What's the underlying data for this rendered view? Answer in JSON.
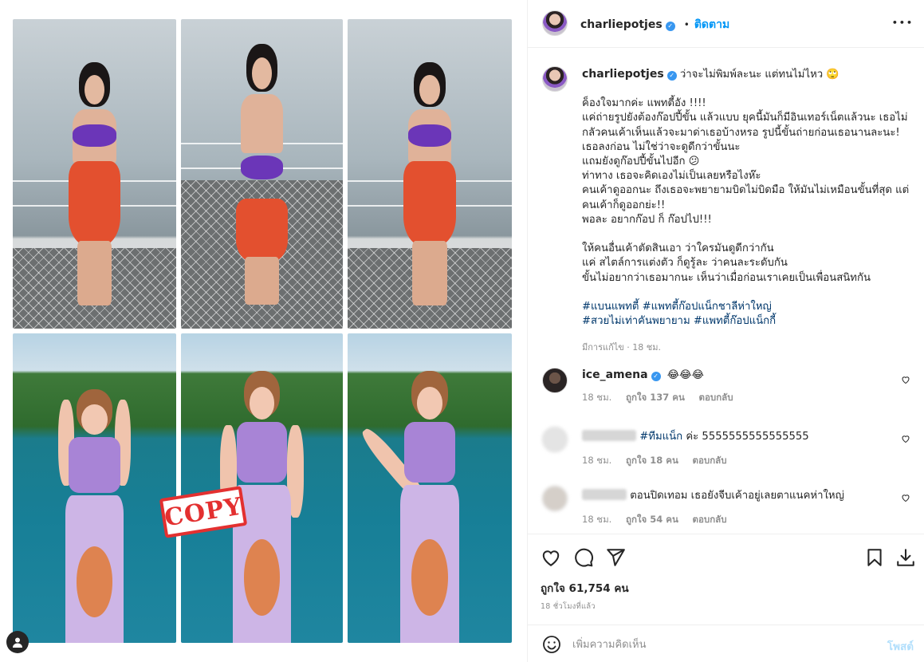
{
  "header": {
    "username": "charliepotjes",
    "verified_icon": "verified-badge-icon",
    "separator": "•",
    "follow_label": "ติดตาม",
    "more_icon": "more-options-icon",
    "more_label": "•••"
  },
  "caption": {
    "username": "charliepotjes",
    "first_line": "ว่าจะไม่พิมพ์ละนะ แต่ทนไม่ไหว 🙄",
    "lines": [
      "ค็องใจมากค่ะ แพทตี้อัง !!!!",
      "แค่ถ่ายรูปยังต้องก๊อปปี้ขั้น แล้วแบบ ยุคนี้มันก็มีอินเทอร์เน็ตแล้วนะ เธอไม่",
      "กลัวคนเค้าเห็นแล้วจะมาด่าเธอบ้างหรอ รูปนี้ขั้นถ่ายก่อนเธอนานละนะ!",
      "เธอลงก่อน ไม่ใช่ว่าจะดูดีกว่าขั้นนะ",
      "แถมยังดูก๊อปปี้ขั้นไปอีก 😕",
      "ท่าทาง เธอจะคิดเองไม่เป็นเลยหรือไงห๊ะ",
      "คนเค้าดูออกนะ ถึงเธอจะพยายามบิดไม่บิดมือ ให้มันไม่เหมือนขั้นที่สุด แต่",
      "คนเค้าก็ดูออกย่ะ!!",
      "พอละ อยากก๊อป ก็ ก๊อปไป!!!",
      "",
      "ให้คนอื่นเค้าตัดสินเอา ว่าใครมันดูดีกว่ากัน",
      "แค่ สไตล์การแต่งตัว ก็ดูรู้ละ ว่าคนละระดับกัน",
      "ขั้นไม่อยากว่าเธอมากนะ เห็นว่าเมื่อก่อนเราเคยเป็นเพื่อนสนิทกัน"
    ],
    "hashtags_line1": "#แบนแพทตี้ #แพทตี้ก๊อปแน็กชาลีห่าใหญ่",
    "hashtags_line2": "#สวยไม่เท่าคันพยายาม #แพทตี้ก๊อปแน็กกี้",
    "meta": "มีการแก้ไข · 18 ชม."
  },
  "comments": [
    {
      "username": "ice_amena",
      "verified": true,
      "text": "😂😂😂",
      "time": "18 ชม.",
      "likes": "ถูกใจ 137 คน",
      "reply": "ตอบกลับ"
    },
    {
      "username": "",
      "hashtag": "#ทีมแน็ก",
      "text": " ค่ะ 5555555555555555",
      "time": "18 ชม.",
      "likes": "ถูกใจ 18 คน",
      "reply": "ตอบกลับ"
    },
    {
      "username": "",
      "text": "ตอนปิดเทอม เธอยังจีบเค้าอยู่เลยตาแนคห่าใหญ่",
      "time": "18 ชม.",
      "likes": "ถูกใจ 54 คน",
      "reply": "ตอบกลับ"
    }
  ],
  "actions": {
    "like_icon": "heart-icon",
    "comment_icon": "comment-icon",
    "share_icon": "share-icon",
    "save_icon": "bookmark-icon",
    "download_icon": "download-icon",
    "likes_text": "ถูกใจ 61,754 คน",
    "posted_time": "18 ชั่วโมงที่แล้ว"
  },
  "add_comment": {
    "emoji_icon": "emoji-icon",
    "placeholder": "เพิ่มความคิดเห็น",
    "post_label": "โพสต์"
  },
  "media": {
    "stamp_text": "COPY",
    "user_icon": "user-icon"
  },
  "colors": {
    "link_blue": "#0095f6",
    "hashtag_blue": "#00376b",
    "verified_blue": "#3897f0",
    "muted_gray": "#8e8e8e",
    "stamp_red": "#e33030"
  }
}
